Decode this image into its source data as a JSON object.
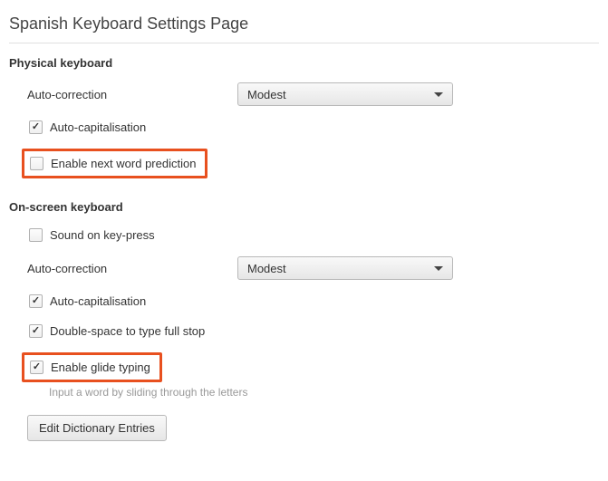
{
  "page": {
    "title": "Spanish Keyboard Settings Page"
  },
  "physical": {
    "heading": "Physical keyboard",
    "auto_correction_label": "Auto-correction",
    "auto_correction_value": "Modest",
    "auto_capitalisation_label": "Auto-capitalisation",
    "auto_capitalisation_checked": true,
    "enable_next_word_prediction_label": "Enable next word prediction",
    "enable_next_word_prediction_checked": false
  },
  "onscreen": {
    "heading": "On-screen keyboard",
    "sound_on_keypress_label": "Sound on key-press",
    "sound_on_keypress_checked": false,
    "auto_correction_label": "Auto-correction",
    "auto_correction_value": "Modest",
    "auto_capitalisation_label": "Auto-capitalisation",
    "auto_capitalisation_checked": true,
    "double_space_label": "Double-space to type full stop",
    "double_space_checked": true,
    "enable_glide_typing_label": "Enable glide typing",
    "enable_glide_typing_checked": true,
    "glide_hint": "Input a word by sliding through the letters",
    "edit_dictionary_label": "Edit Dictionary Entries"
  }
}
